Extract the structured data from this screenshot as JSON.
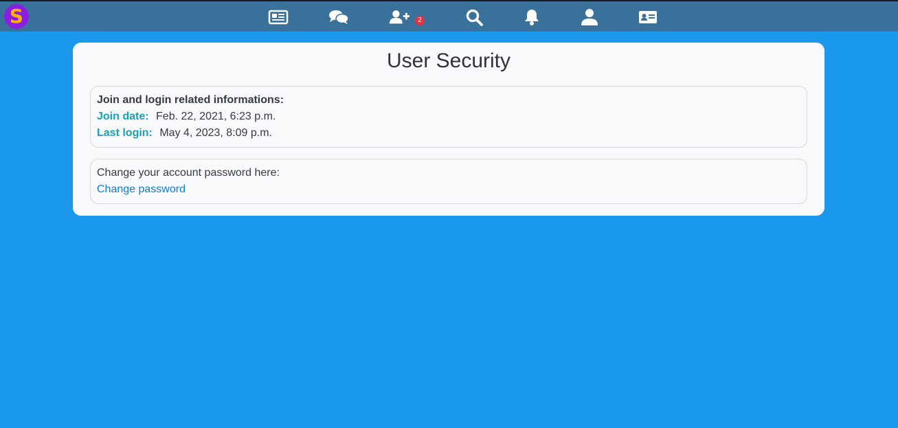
{
  "navbar": {
    "logo_letter": "S",
    "logo_color": "#8b1fe0",
    "logo_letter_color": "#ffb000",
    "icons": [
      {
        "name": "newspaper-icon"
      },
      {
        "name": "chat-bubbles-icon"
      },
      {
        "name": "user-plus-icon",
        "badge": "2"
      },
      {
        "name": "search-icon"
      },
      {
        "name": "bell-icon"
      },
      {
        "name": "user-icon"
      },
      {
        "name": "id-card-icon"
      }
    ],
    "badge_color": "#dc3545"
  },
  "main": {
    "title": "User Security",
    "join_panel": {
      "heading": "Join and login related informations:",
      "join_label": "Join date:",
      "join_value": "Feb. 22, 2021, 6:23 p.m.",
      "login_label": "Last login:",
      "login_value": "May 4, 2023, 8:09 p.m."
    },
    "password_panel": {
      "text": "Change your account password here:",
      "link_label": "Change password"
    }
  },
  "colors": {
    "background": "#1a98ec",
    "navbar": "#39719b",
    "label_accent": "#17a2b8",
    "link": "#0d7ee0"
  }
}
